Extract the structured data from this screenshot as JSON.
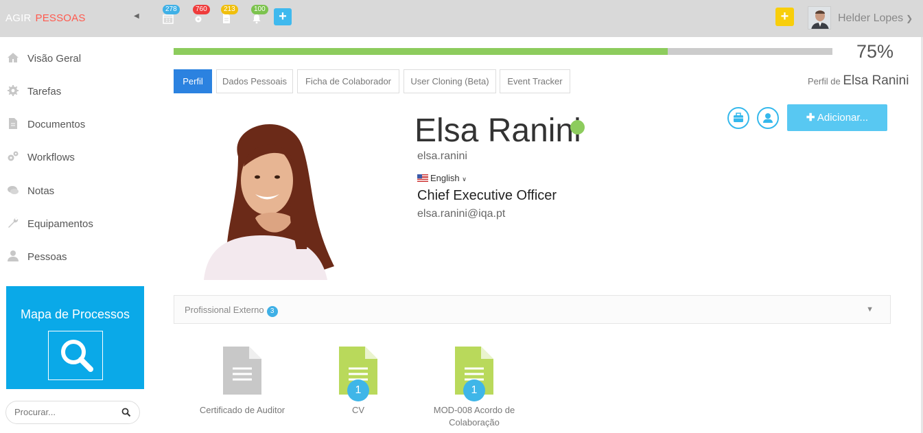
{
  "app": {
    "brand_primary": "AGIR",
    "brand_secondary": "PESSOAS"
  },
  "topbar": {
    "notifications": [
      {
        "count": "278",
        "icon": "calendar-icon",
        "color": "#3fb0e6"
      },
      {
        "count": "760",
        "icon": "gear-icon",
        "color": "#ef3b3b"
      },
      {
        "count": "213",
        "icon": "document-icon",
        "color": "#f0bf0c"
      },
      {
        "count": "100",
        "icon": "bell-icon",
        "color": "#7cc34e"
      }
    ],
    "plus_label": "+",
    "quick_add_label": "+",
    "user_name": "Helder Lopes"
  },
  "sidebar": {
    "items": [
      {
        "label": "Visão Geral",
        "icon": "home-icon"
      },
      {
        "label": "Tarefas",
        "icon": "gear-icon"
      },
      {
        "label": "Documentos",
        "icon": "document-icon"
      },
      {
        "label": "Workflows",
        "icon": "gears-icon"
      },
      {
        "label": "Notas",
        "icon": "chat-icon"
      },
      {
        "label": "Equipamentos",
        "icon": "wrench-icon"
      },
      {
        "label": "Pessoas",
        "icon": "person-icon"
      }
    ],
    "process_map_title": "Mapa de Processos",
    "search_placeholder": "Procurar..."
  },
  "progress": {
    "value": 75,
    "label": "75%"
  },
  "tabs": [
    {
      "label": "Perfil",
      "active": true
    },
    {
      "label": "Dados Pessoais",
      "active": false
    },
    {
      "label": "Ficha de Colaborador",
      "active": false
    },
    {
      "label": "User Cloning (Beta)",
      "active": false
    },
    {
      "label": "Event Tracker",
      "active": false
    }
  ],
  "profile_of": {
    "prefix": "Perfil de",
    "name": "Elsa Ranini"
  },
  "profile": {
    "name": "Elsa Ranini",
    "username": "elsa.ranini",
    "language": "English",
    "job_title": "Chief Executive Officer",
    "email": "elsa.ranini@iqa.pt",
    "status_color": "#8dcc5d"
  },
  "actions": {
    "add_label": "Adicionar..."
  },
  "panel": {
    "title": "Profissional Externo",
    "count": "3"
  },
  "documents": [
    {
      "label": "Certificado de Auditor",
      "color": "#c8c8c8",
      "count": ""
    },
    {
      "label": "CV",
      "color": "#b9d95b",
      "count": "1"
    },
    {
      "label": "MOD-008 Acordo de Colaboração",
      "color": "#b9d95b",
      "count": "1"
    }
  ]
}
